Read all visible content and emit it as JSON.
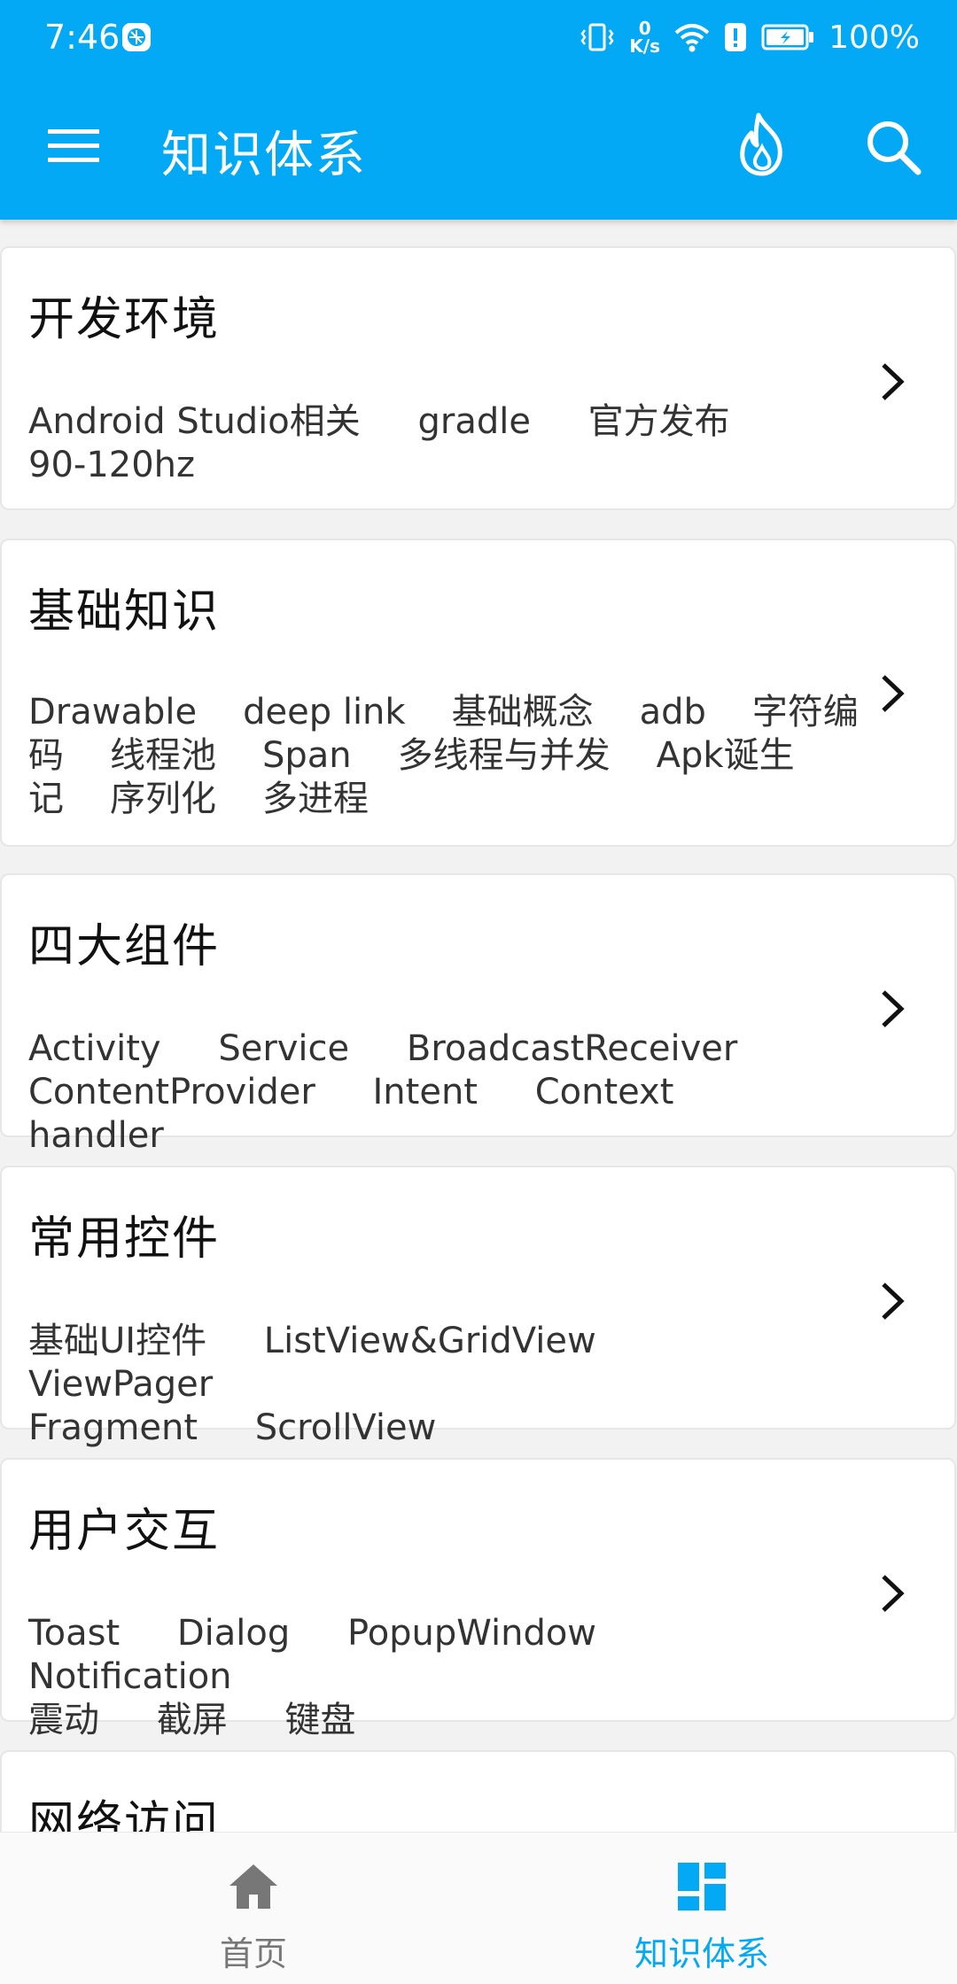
{
  "status_bar": {
    "time": "7:46",
    "net_speed_value": "0",
    "net_speed_unit": "K/s",
    "battery": "100%"
  },
  "toolbar": {
    "title": "知识体系",
    "background": "#03a9f4"
  },
  "categories": [
    {
      "title": "开发环境",
      "tags": [
        "Android Studio相关",
        "gradle",
        "官方发布",
        "90-120hz"
      ]
    },
    {
      "title": "基础知识",
      "tags": [
        "Drawable",
        "deep link",
        "基础概念",
        "adb",
        "字符编码",
        "线程池",
        "Span",
        "多线程与并发",
        "Apk诞生记",
        "序列化",
        "多进程"
      ]
    },
    {
      "title": "四大组件",
      "tags": [
        "Activity",
        "Service",
        "BroadcastReceiver",
        "ContentProvider",
        "Intent",
        "Context",
        "handler"
      ]
    },
    {
      "title": "常用控件",
      "tags": [
        "基础UI控件",
        "ListView&GridView",
        "ViewPager",
        "Fragment",
        "ScrollView"
      ]
    },
    {
      "title": "用户交互",
      "tags": [
        "Toast",
        "Dialog",
        "PopupWindow",
        "Notification",
        "震动",
        "截屏",
        "键盘"
      ]
    },
    {
      "title": "网络访问",
      "tags": []
    }
  ],
  "bottom_nav": {
    "items": [
      {
        "label": "首页",
        "icon": "home-icon",
        "active": false
      },
      {
        "label": "知识体系",
        "icon": "dashboard-icon",
        "active": true
      }
    ],
    "active_color": "#03a9f4",
    "inactive_color": "#777777"
  }
}
